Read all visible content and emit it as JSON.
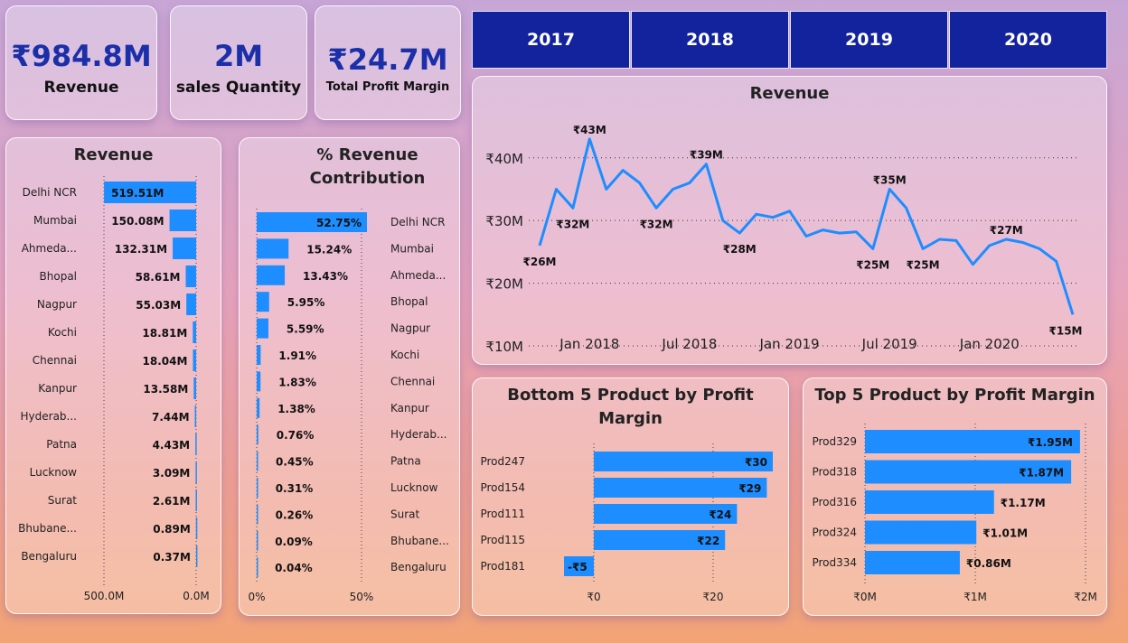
{
  "kpis": {
    "revenue": {
      "value": "₹984.8M",
      "label": "Revenue"
    },
    "quantity": {
      "value": "2M",
      "label": "sales Quantity"
    },
    "profit": {
      "value": "₹24.7M",
      "label": "Total Profit Margin"
    }
  },
  "years": [
    "2017",
    "2018",
    "2019",
    "2020"
  ],
  "colors": {
    "bar": "#1e8dff",
    "year_button": "#13239e",
    "kpi_value": "#1b2fa8"
  },
  "chart_data": [
    {
      "id": "city_revenue",
      "type": "bar",
      "orientation": "horizontal",
      "title": "Revenue",
      "categories": [
        "Delhi NCR",
        "Mumbai",
        "Ahmeda...",
        "Bhopal",
        "Nagpur",
        "Kochi",
        "Chennai",
        "Kanpur",
        "Hyderab...",
        "Patna",
        "Lucknow",
        "Surat",
        "Bhubane...",
        "Bengaluru"
      ],
      "values": [
        519.51,
        150.08,
        132.31,
        58.61,
        55.03,
        18.81,
        18.04,
        13.58,
        7.44,
        4.43,
        3.09,
        2.61,
        0.89,
        0.37
      ],
      "value_labels": [
        "519.51M",
        "150.08M",
        "132.31M",
        "58.61M",
        "55.03M",
        "18.81M",
        "18.04M",
        "13.58M",
        "7.44M",
        "4.43M",
        "3.09M",
        "2.61M",
        "0.89M",
        "0.37M"
      ],
      "xticks": [
        "500.0M",
        "0.0M"
      ],
      "xlim": [
        0,
        520
      ],
      "x_reversed": true
    },
    {
      "id": "revenue_contribution",
      "type": "bar",
      "orientation": "horizontal",
      "title": "% Revenue Contribution",
      "categories": [
        "Delhi NCR",
        "Mumbai",
        "Ahmeda...",
        "Bhopal",
        "Nagpur",
        "Kochi",
        "Chennai",
        "Kanpur",
        "Hyderab...",
        "Patna",
        "Lucknow",
        "Surat",
        "Bhubane...",
        "Bengaluru"
      ],
      "values": [
        52.75,
        15.24,
        13.43,
        5.95,
        5.59,
        1.91,
        1.83,
        1.38,
        0.76,
        0.45,
        0.31,
        0.26,
        0.09,
        0.04
      ],
      "value_labels": [
        "52.75%",
        "15.24%",
        "13.43%",
        "5.95%",
        "5.59%",
        "1.91%",
        "1.83%",
        "1.38%",
        "0.76%",
        "0.45%",
        "0.31%",
        "0.26%",
        "0.09%",
        "0.04%"
      ],
      "xticks": [
        "0%",
        "50%"
      ],
      "xlim": [
        0,
        52.75
      ]
    },
    {
      "id": "revenue_trend",
      "type": "line",
      "title": "Revenue",
      "x": [
        "2017-10",
        "2017-11",
        "2017-12",
        "2018-01",
        "2018-02",
        "2018-03",
        "2018-04",
        "2018-05",
        "2018-06",
        "2018-07",
        "2018-08",
        "2018-09",
        "2018-10",
        "2018-11",
        "2018-12",
        "2019-01",
        "2019-02",
        "2019-03",
        "2019-04",
        "2019-05",
        "2019-06",
        "2019-07",
        "2019-08",
        "2019-09",
        "2019-10",
        "2019-11",
        "2019-12",
        "2020-01",
        "2020-02",
        "2020-03",
        "2020-04",
        "2020-05",
        "2020-06"
      ],
      "y": [
        26,
        35,
        32,
        43,
        35,
        38,
        36,
        32,
        35,
        36,
        39,
        30,
        28,
        31,
        30.5,
        31.5,
        27.5,
        28.5,
        28,
        28.2,
        25.5,
        35,
        32,
        25.5,
        27,
        26.8,
        23,
        26,
        27,
        26.5,
        25.5,
        23.5,
        15
      ],
      "point_labels": [
        {
          "index": 0,
          "text": "₹26M"
        },
        {
          "index": 2,
          "text": "₹32M"
        },
        {
          "index": 3,
          "text": "₹43M"
        },
        {
          "index": 7,
          "text": "₹32M"
        },
        {
          "index": 10,
          "text": "₹39M"
        },
        {
          "index": 12,
          "text": "₹28M"
        },
        {
          "index": 20,
          "text": "₹25M"
        },
        {
          "index": 21,
          "text": "₹35M"
        },
        {
          "index": 23,
          "text": "₹25M"
        },
        {
          "index": 28,
          "text": "₹27M"
        },
        {
          "index": 32,
          "text": "₹15M"
        }
      ],
      "yticks": [
        10,
        20,
        30,
        40
      ],
      "ytick_labels": [
        "₹10M",
        "₹20M",
        "₹30M",
        "₹40M"
      ],
      "xticks": [
        "2018-01",
        "2018-07",
        "2019-01",
        "2019-07",
        "2020-01"
      ],
      "xtick_labels": [
        "Jan 2018",
        "Jul 2018",
        "Jan 2019",
        "Jul 2019",
        "Jan 2020"
      ],
      "ylim": [
        10,
        44
      ],
      "grid": true
    },
    {
      "id": "bottom5",
      "type": "bar",
      "orientation": "horizontal",
      "title": "Bottom 5 Product by Profit Margin",
      "categories": [
        "Prod247",
        "Prod154",
        "Prod111",
        "Prod115",
        "Prod181"
      ],
      "values": [
        30,
        29,
        24,
        22,
        -5
      ],
      "value_labels": [
        "₹30",
        "₹29",
        "₹24",
        "₹22",
        "-₹5"
      ],
      "xticks": [
        0,
        20
      ],
      "xtick_labels": [
        "₹0",
        "₹20"
      ],
      "xlim": [
        -6,
        30
      ]
    },
    {
      "id": "top5",
      "type": "bar",
      "orientation": "horizontal",
      "title": "Top 5 Product by Profit Margin",
      "categories": [
        "Prod329",
        "Prod318",
        "Prod316",
        "Prod324",
        "Prod334"
      ],
      "values": [
        1.95,
        1.87,
        1.17,
        1.01,
        0.86
      ],
      "value_labels": [
        "₹1.95M",
        "₹1.87M",
        "₹1.17M",
        "₹1.01M",
        "₹0.86M"
      ],
      "xticks": [
        0,
        1,
        2
      ],
      "xtick_labels": [
        "₹0M",
        "₹1M",
        "₹2M"
      ],
      "xlim": [
        0,
        2
      ]
    }
  ]
}
